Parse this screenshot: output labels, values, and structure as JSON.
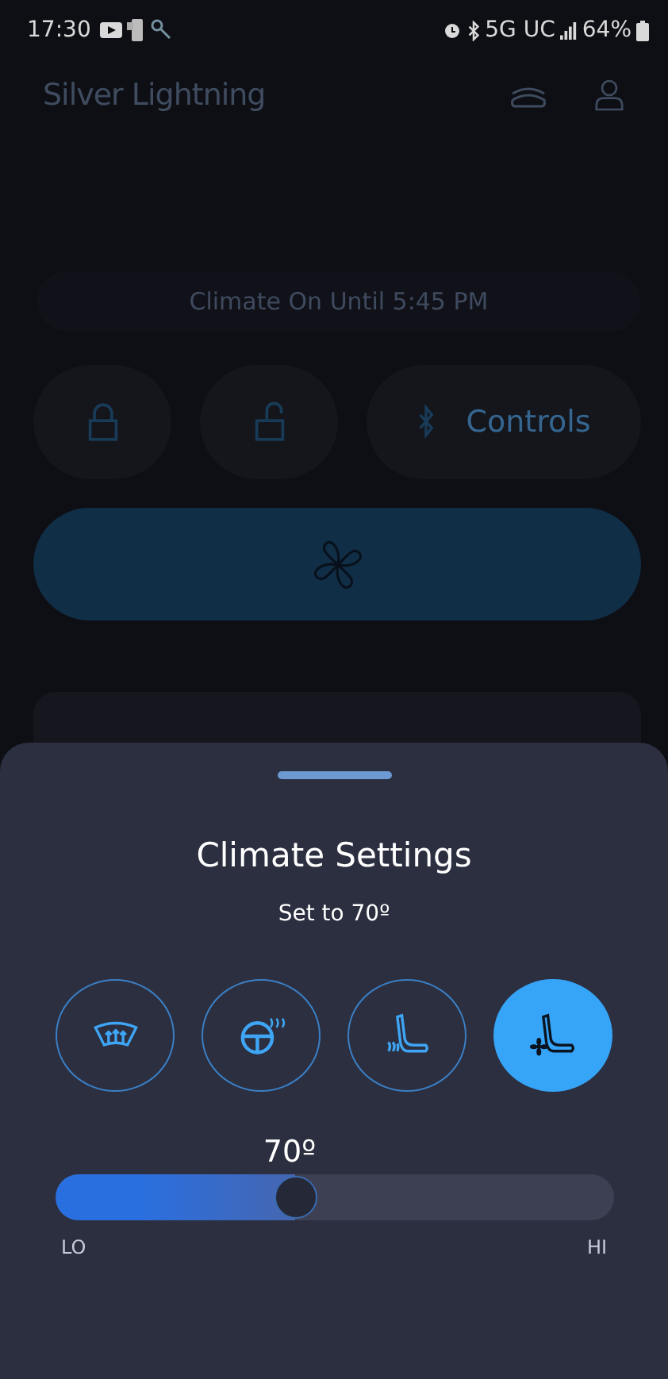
{
  "status_bar": {
    "time": "17:30",
    "network": "5G UC",
    "battery": "64%"
  },
  "header": {
    "title": "Silver Lightning"
  },
  "climate_banner": "Climate On Until 5:45 PM",
  "quick_actions": [
    {
      "kind": "lock"
    },
    {
      "kind": "unlock"
    },
    {
      "kind": "controls",
      "label": "Controls"
    }
  ],
  "climate_button": {
    "kind": "fan"
  },
  "background_card": {
    "kind": "card"
  },
  "sheet": {
    "title": "Climate Settings",
    "subtitle": "Set to 70º",
    "options": [
      {
        "kind": "defrost",
        "selected": false
      },
      {
        "kind": "wheel",
        "selected": false
      },
      {
        "kind": "heated-seat",
        "selected": false
      },
      {
        "kind": "cooled-seat",
        "selected": true
      }
    ],
    "temperature": {
      "reading": "70º",
      "level": 0.43,
      "min_label": "LO",
      "max_label": "HI"
    }
  }
}
